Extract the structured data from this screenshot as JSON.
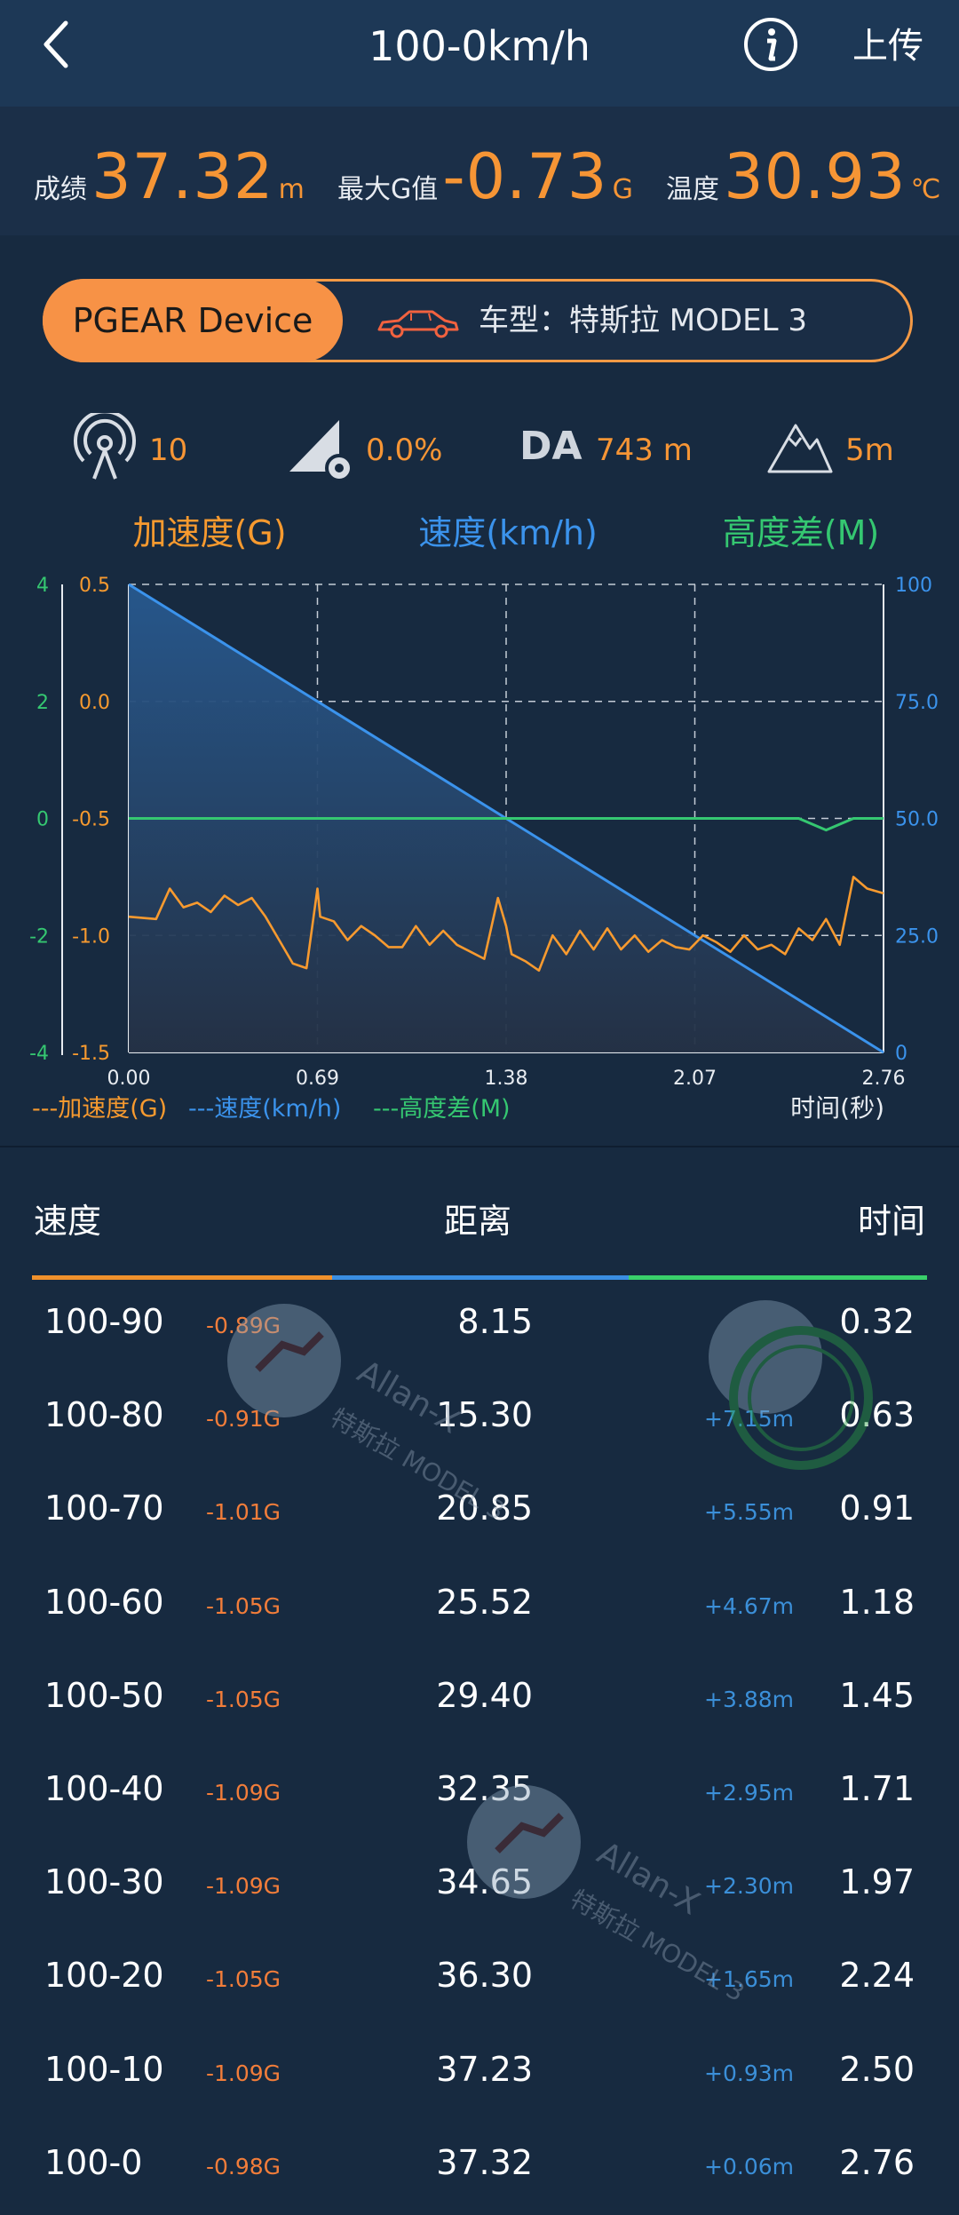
{
  "header": {
    "title": "100-0km/h",
    "upload_label": "上传",
    "back_icon": "chevron-left-icon",
    "info_icon": "info-icon"
  },
  "summary": {
    "score_label": "成绩",
    "score_value": "37.32",
    "score_unit": "m",
    "maxg_label": "最大G值",
    "maxg_value": "-0.73",
    "maxg_unit": "G",
    "temp_label": "温度",
    "temp_value": "30.93",
    "temp_unit": "℃"
  },
  "device": {
    "name": "PGEAR Device",
    "model": "车型：特斯拉 MODEL 3"
  },
  "sensors": {
    "satellites": "10",
    "slope": "0.0%",
    "da_label": "DA",
    "da_value": "743 m",
    "elevation": "5m"
  },
  "chart_data": {
    "type": "line",
    "legend_top": [
      "加速度(G)",
      "速度(km/h)",
      "高度差(M)"
    ],
    "legend_bottom": [
      "---加速度(G)",
      "---速度(km/h)",
      "---高度差(M)"
    ],
    "xlabel": "时间(秒)",
    "x_ticks": [
      "0.00",
      "0.69",
      "1.38",
      "2.07",
      "2.76"
    ],
    "xlim": [
      0,
      2.76
    ],
    "left_green_ticks": [
      "4",
      "2",
      "0",
      "-2",
      "-4"
    ],
    "left_orange_ticks": [
      "0.5",
      "0.0",
      "-0.5",
      "-1.0",
      "-1.5"
    ],
    "right_blue_ticks": [
      "100",
      "75.0",
      "50.0",
      "25.0",
      "0"
    ],
    "colors": {
      "accel": "#f79a2f",
      "speed": "#3b93ec",
      "altitude": "#35c771"
    },
    "series": [
      {
        "name": "速度(km/h)",
        "x": [
          0,
          0.69,
          1.38,
          2.07,
          2.76
        ],
        "values": [
          100,
          75,
          50,
          25,
          0
        ]
      },
      {
        "name": "高度差(M)",
        "x": [
          0,
          2.45,
          2.55,
          2.65,
          2.76
        ],
        "values": [
          0,
          0,
          -0.2,
          0,
          0
        ]
      },
      {
        "name": "加速度(G)",
        "x": [
          0,
          0.1,
          0.15,
          0.2,
          0.25,
          0.3,
          0.35,
          0.4,
          0.45,
          0.5,
          0.55,
          0.6,
          0.65,
          0.69,
          0.7,
          0.75,
          0.8,
          0.85,
          0.9,
          0.95,
          1.0,
          1.05,
          1.1,
          1.15,
          1.2,
          1.25,
          1.3,
          1.35,
          1.38,
          1.4,
          1.45,
          1.5,
          1.55,
          1.6,
          1.65,
          1.7,
          1.75,
          1.8,
          1.85,
          1.9,
          1.95,
          2.0,
          2.05,
          2.1,
          2.15,
          2.2,
          2.25,
          2.3,
          2.35,
          2.4,
          2.45,
          2.5,
          2.55,
          2.6,
          2.65,
          2.7,
          2.76
        ],
        "values": [
          -0.92,
          -0.93,
          -0.8,
          -0.88,
          -0.86,
          -0.9,
          -0.83,
          -0.87,
          -0.84,
          -0.92,
          -1.02,
          -1.12,
          -1.14,
          -0.8,
          -0.92,
          -0.94,
          -1.02,
          -0.96,
          -1.0,
          -1.05,
          -1.05,
          -0.96,
          -1.04,
          -0.98,
          -1.04,
          -1.07,
          -1.1,
          -0.84,
          -0.96,
          -1.08,
          -1.11,
          -1.15,
          -1.0,
          -1.08,
          -0.98,
          -1.06,
          -0.97,
          -1.06,
          -1.0,
          -1.07,
          -1.02,
          -1.05,
          -1.06,
          -1.0,
          -1.03,
          -1.07,
          -1.0,
          -1.06,
          -1.04,
          -1.08,
          -0.97,
          -1.02,
          -0.93,
          -1.04,
          -0.75,
          -0.8,
          -0.82
        ]
      }
    ]
  },
  "table": {
    "headers": [
      "速度",
      "距离",
      "时间"
    ],
    "rows": [
      {
        "speed": "100-90",
        "g": "-0.89G",
        "distance": "8.15",
        "delta": "",
        "time": "0.32"
      },
      {
        "speed": "100-80",
        "g": "-0.91G",
        "distance": "15.30",
        "delta": "+7.15m",
        "time": "0.63"
      },
      {
        "speed": "100-70",
        "g": "-1.01G",
        "distance": "20.85",
        "delta": "+5.55m",
        "time": "0.91"
      },
      {
        "speed": "100-60",
        "g": "-1.05G",
        "distance": "25.52",
        "delta": "+4.67m",
        "time": "1.18"
      },
      {
        "speed": "100-50",
        "g": "-1.05G",
        "distance": "29.40",
        "delta": "+3.88m",
        "time": "1.45"
      },
      {
        "speed": "100-40",
        "g": "-1.09G",
        "distance": "32.35",
        "delta": "+2.95m",
        "time": "1.71"
      },
      {
        "speed": "100-30",
        "g": "-1.09G",
        "distance": "34.65",
        "delta": "+2.30m",
        "time": "1.97"
      },
      {
        "speed": "100-20",
        "g": "-1.05G",
        "distance": "36.30",
        "delta": "+1.65m",
        "time": "2.24"
      },
      {
        "speed": "100-10",
        "g": "-1.09G",
        "distance": "37.23",
        "delta": "+0.93m",
        "time": "2.50"
      },
      {
        "speed": "100-0",
        "g": "-0.98G",
        "distance": "37.32",
        "delta": "+0.06m",
        "time": "2.76"
      }
    ]
  },
  "watermark": {
    "author": "Allan-X",
    "car": "特斯拉 MODEL 3"
  }
}
